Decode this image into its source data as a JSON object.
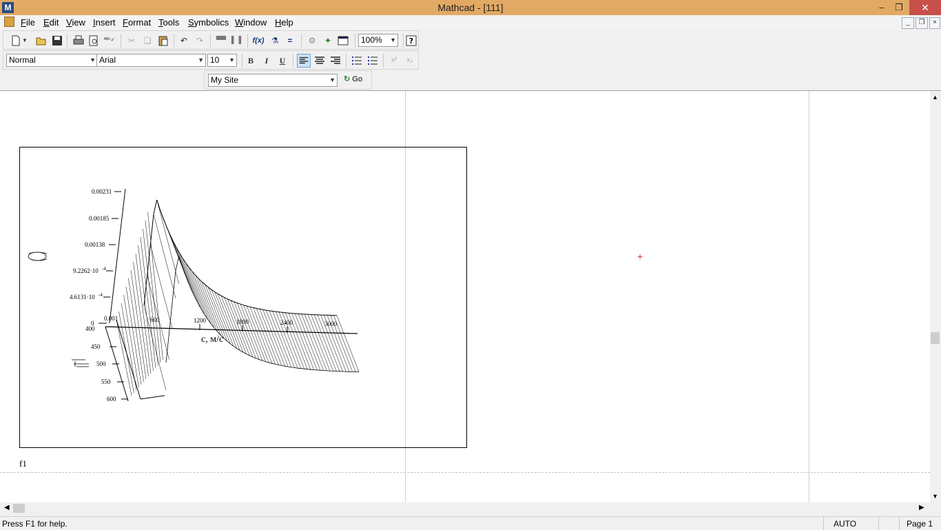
{
  "window": {
    "title": "Mathcad - [111]",
    "app_icon": "M",
    "controls": {
      "minimize": "–",
      "restore": "❐",
      "close": "✕"
    }
  },
  "menu": [
    {
      "label": "File",
      "key": "F",
      "rest": "ile"
    },
    {
      "label": "Edit",
      "key": "E",
      "rest": "dit"
    },
    {
      "label": "View",
      "key": "V",
      "rest": "iew"
    },
    {
      "label": "Insert",
      "key": "I",
      "rest": "nsert"
    },
    {
      "label": "Format",
      "key": "F",
      "rest": "ormat"
    },
    {
      "label": "Tools",
      "key": "T",
      "rest": "ools"
    },
    {
      "label": "Symbolics",
      "key": "S",
      "rest": "ymbolics"
    },
    {
      "label": "Window",
      "key": "W",
      "rest": "indow"
    },
    {
      "label": "Help",
      "key": "H",
      "rest": "elp"
    }
  ],
  "toolbar_standard": {
    "zoom": "100%",
    "icons": [
      "new-icon",
      "dropdown-icon",
      "open-icon",
      "save-icon",
      "print-icon",
      "print-preview-icon",
      "spellcheck-icon",
      "cut-icon",
      "copy-icon",
      "paste-icon",
      "undo-icon",
      "redo-icon",
      "align-horizontal-icon",
      "align-vertical-icon",
      "insert-function-icon",
      "insert-unit-icon",
      "calculate-icon",
      "component-icon",
      "resources-icon",
      "window-icon",
      "help-icon"
    ]
  },
  "toolbar_formatting": {
    "style": "Normal",
    "font": "Arial",
    "size": "10",
    "bold": "B",
    "italic": "I",
    "underline": "U",
    "superscript": "x²",
    "subscript": "x₂"
  },
  "toolbar_web": {
    "site": "My Site",
    "go": "Go"
  },
  "plot": {
    "z_ticks": [
      "0.00231",
      "0.00185",
      "0.00138",
      "9.2262·10",
      "4.6131·10",
      "0"
    ],
    "z_tick_exp": "-4",
    "y_ticks": [
      "400",
      "450",
      "500",
      "550",
      "600"
    ],
    "x_ticks": [
      "0.001",
      "600",
      "1200",
      "1800",
      "2400",
      "3000"
    ],
    "x_axis_label": "с, м/с",
    "region_label": "f1"
  },
  "status": {
    "help": "Press F1 for help.",
    "mode": "AUTO",
    "page": "Page 1"
  }
}
